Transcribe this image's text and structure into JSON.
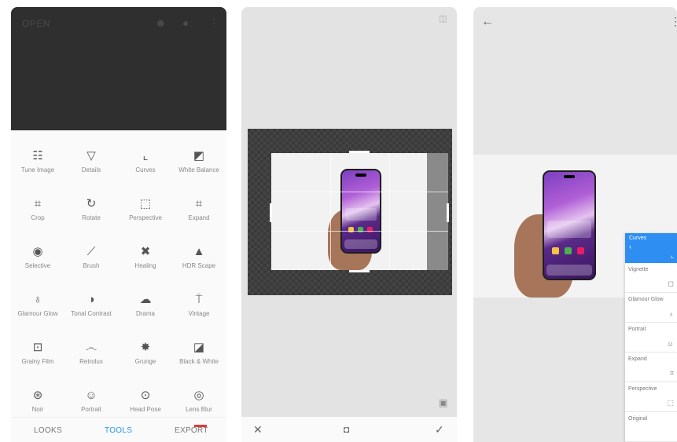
{
  "screen1": {
    "header": {
      "open_label": "OPEN"
    },
    "icons": {
      "top1": "face-icon",
      "top2": "info-icon",
      "top3": "more-vert-icon"
    },
    "tools": [
      {
        "label": "Tune Image",
        "icon": "tune-icon",
        "glyph": "☷"
      },
      {
        "label": "Details",
        "icon": "details-triangle-icon",
        "glyph": "▽"
      },
      {
        "label": "Curves",
        "icon": "curves-icon",
        "glyph": "⌞"
      },
      {
        "label": "White Balance",
        "icon": "white-balance-icon",
        "glyph": "◩"
      },
      {
        "label": "Crop",
        "icon": "crop-icon",
        "glyph": "⌗"
      },
      {
        "label": "Rotate",
        "icon": "rotate-icon",
        "glyph": "↻"
      },
      {
        "label": "Perspective",
        "icon": "perspective-icon",
        "glyph": "⬚"
      },
      {
        "label": "Expand",
        "icon": "expand-icon",
        "glyph": "⌗"
      },
      {
        "label": "Selective",
        "icon": "selective-icon",
        "glyph": "◉"
      },
      {
        "label": "Brush",
        "icon": "brush-icon",
        "glyph": "⟋"
      },
      {
        "label": "Healing",
        "icon": "healing-icon",
        "glyph": "✖"
      },
      {
        "label": "HDR Scape",
        "icon": "hdr-scape-icon",
        "glyph": "▲"
      },
      {
        "label": "Glamour Glow",
        "icon": "glamour-glow-icon",
        "glyph": "♁"
      },
      {
        "label": "Tonal Contrast",
        "icon": "tonal-contrast-icon",
        "glyph": "◑"
      },
      {
        "label": "Drama",
        "icon": "drama-cloud-icon",
        "glyph": "☁"
      },
      {
        "label": "Vintage",
        "icon": "vintage-icon",
        "glyph": "⍑"
      },
      {
        "label": "Grainy Film",
        "icon": "grainy-film-icon",
        "glyph": "⊡"
      },
      {
        "label": "Retrolux",
        "icon": "retrolux-mustache-icon",
        "glyph": "෴"
      },
      {
        "label": "Grunge",
        "icon": "grunge-icon",
        "glyph": "✸"
      },
      {
        "label": "Black & White",
        "icon": "black-white-icon",
        "glyph": "◪"
      },
      {
        "label": "Noir",
        "icon": "noir-icon",
        "glyph": "⊛"
      },
      {
        "label": "Portrait",
        "icon": "portrait-icon",
        "glyph": "☺"
      },
      {
        "label": "Head Pose",
        "icon": "head-pose-icon",
        "glyph": "⊙"
      },
      {
        "label": "Lens Blur",
        "icon": "lens-blur-icon",
        "glyph": "◎"
      }
    ],
    "nav": {
      "looks": "LOOKS",
      "tools": "TOOLS",
      "export": "EXPORT"
    }
  },
  "screen2": {
    "icons": {
      "compare": "compare-icon",
      "bookmark": "bookmark-icon",
      "cancel": "close-icon",
      "styles": "stack-icon",
      "apply": "check-icon"
    },
    "glyphs": {
      "compare": "◫",
      "bookmark": "▣",
      "cancel": "✕",
      "styles": "◘",
      "apply": "✓"
    }
  },
  "screen3": {
    "icons": {
      "back": "arrow-back-icon",
      "more": "more-vert-icon"
    },
    "glyphs": {
      "back": "←",
      "more": "⋮"
    },
    "history": {
      "header_title": "Curves",
      "back_glyph": "‹",
      "items": [
        {
          "label": "Vignette",
          "icon": "vignette-icon",
          "glyph": "◻"
        },
        {
          "label": "Glamour Glow",
          "icon": "glamour-glow-icon",
          "glyph": "♁"
        },
        {
          "label": "Portrait",
          "icon": "portrait-icon",
          "glyph": "☺"
        },
        {
          "label": "Expand",
          "icon": "expand-icon",
          "glyph": "⌗"
        },
        {
          "label": "Perspective",
          "icon": "perspective-icon",
          "glyph": "⬚"
        },
        {
          "label": "Original",
          "icon": "",
          "glyph": ""
        }
      ]
    }
  }
}
